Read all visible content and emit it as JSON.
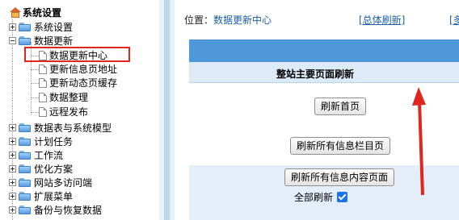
{
  "sidebar": {
    "root_label": "系统设置",
    "nodes": [
      {
        "label": "系统设置"
      },
      {
        "label": "数据更新"
      },
      {
        "label": "数据更新中心"
      },
      {
        "label": "更新信息页地址"
      },
      {
        "label": "更新动态页缓存"
      },
      {
        "label": "数据整理"
      },
      {
        "label": "远程发布"
      },
      {
        "label": "数据表与系统模型"
      },
      {
        "label": "计划任务"
      },
      {
        "label": "工作流"
      },
      {
        "label": "优化方案"
      },
      {
        "label": "网站多访问端"
      },
      {
        "label": "扩展菜单"
      },
      {
        "label": "备份与恢复数据"
      }
    ]
  },
  "header": {
    "location_prefix": "位置：",
    "location_link": "数据更新中心",
    "refresh_all": "[总体刷新]",
    "cut_link": "[多"
  },
  "panel": {
    "title": "整站主要页面刷新",
    "buttons": {
      "refresh_home": "刷新首页",
      "refresh_columns": "刷新所有信息栏目页",
      "refresh_content": "刷新所有信息内容页面"
    },
    "full_refresh_label": "全部刷新",
    "full_refresh_checked": true
  },
  "colors": {
    "header_blue": "#4e97d8",
    "highlight_red": "#e0271f",
    "arrow_red": "#e0271f"
  }
}
